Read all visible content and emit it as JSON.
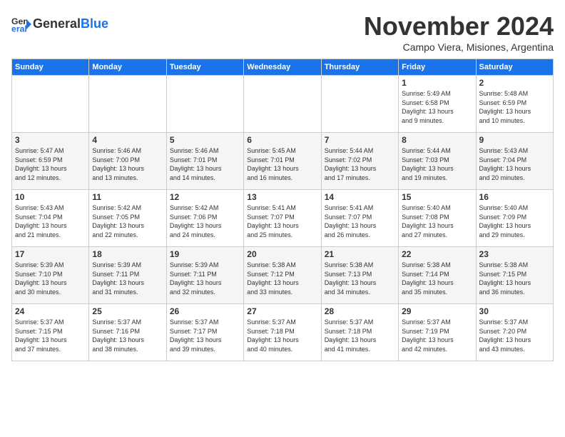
{
  "header": {
    "logo_general": "General",
    "logo_blue": "Blue",
    "month": "November 2024",
    "location": "Campo Viera, Misiones, Argentina"
  },
  "days_of_week": [
    "Sunday",
    "Monday",
    "Tuesday",
    "Wednesday",
    "Thursday",
    "Friday",
    "Saturday"
  ],
  "weeks": [
    [
      {
        "day": "",
        "info": ""
      },
      {
        "day": "",
        "info": ""
      },
      {
        "day": "",
        "info": ""
      },
      {
        "day": "",
        "info": ""
      },
      {
        "day": "",
        "info": ""
      },
      {
        "day": "1",
        "info": "Sunrise: 5:49 AM\nSunset: 6:58 PM\nDaylight: 13 hours\nand 9 minutes."
      },
      {
        "day": "2",
        "info": "Sunrise: 5:48 AM\nSunset: 6:59 PM\nDaylight: 13 hours\nand 10 minutes."
      }
    ],
    [
      {
        "day": "3",
        "info": "Sunrise: 5:47 AM\nSunset: 6:59 PM\nDaylight: 13 hours\nand 12 minutes."
      },
      {
        "day": "4",
        "info": "Sunrise: 5:46 AM\nSunset: 7:00 PM\nDaylight: 13 hours\nand 13 minutes."
      },
      {
        "day": "5",
        "info": "Sunrise: 5:46 AM\nSunset: 7:01 PM\nDaylight: 13 hours\nand 14 minutes."
      },
      {
        "day": "6",
        "info": "Sunrise: 5:45 AM\nSunset: 7:01 PM\nDaylight: 13 hours\nand 16 minutes."
      },
      {
        "day": "7",
        "info": "Sunrise: 5:44 AM\nSunset: 7:02 PM\nDaylight: 13 hours\nand 17 minutes."
      },
      {
        "day": "8",
        "info": "Sunrise: 5:44 AM\nSunset: 7:03 PM\nDaylight: 13 hours\nand 19 minutes."
      },
      {
        "day": "9",
        "info": "Sunrise: 5:43 AM\nSunset: 7:04 PM\nDaylight: 13 hours\nand 20 minutes."
      }
    ],
    [
      {
        "day": "10",
        "info": "Sunrise: 5:43 AM\nSunset: 7:04 PM\nDaylight: 13 hours\nand 21 minutes."
      },
      {
        "day": "11",
        "info": "Sunrise: 5:42 AM\nSunset: 7:05 PM\nDaylight: 13 hours\nand 22 minutes."
      },
      {
        "day": "12",
        "info": "Sunrise: 5:42 AM\nSunset: 7:06 PM\nDaylight: 13 hours\nand 24 minutes."
      },
      {
        "day": "13",
        "info": "Sunrise: 5:41 AM\nSunset: 7:07 PM\nDaylight: 13 hours\nand 25 minutes."
      },
      {
        "day": "14",
        "info": "Sunrise: 5:41 AM\nSunset: 7:07 PM\nDaylight: 13 hours\nand 26 minutes."
      },
      {
        "day": "15",
        "info": "Sunrise: 5:40 AM\nSunset: 7:08 PM\nDaylight: 13 hours\nand 27 minutes."
      },
      {
        "day": "16",
        "info": "Sunrise: 5:40 AM\nSunset: 7:09 PM\nDaylight: 13 hours\nand 29 minutes."
      }
    ],
    [
      {
        "day": "17",
        "info": "Sunrise: 5:39 AM\nSunset: 7:10 PM\nDaylight: 13 hours\nand 30 minutes."
      },
      {
        "day": "18",
        "info": "Sunrise: 5:39 AM\nSunset: 7:11 PM\nDaylight: 13 hours\nand 31 minutes."
      },
      {
        "day": "19",
        "info": "Sunrise: 5:39 AM\nSunset: 7:11 PM\nDaylight: 13 hours\nand 32 minutes."
      },
      {
        "day": "20",
        "info": "Sunrise: 5:38 AM\nSunset: 7:12 PM\nDaylight: 13 hours\nand 33 minutes."
      },
      {
        "day": "21",
        "info": "Sunrise: 5:38 AM\nSunset: 7:13 PM\nDaylight: 13 hours\nand 34 minutes."
      },
      {
        "day": "22",
        "info": "Sunrise: 5:38 AM\nSunset: 7:14 PM\nDaylight: 13 hours\nand 35 minutes."
      },
      {
        "day": "23",
        "info": "Sunrise: 5:38 AM\nSunset: 7:15 PM\nDaylight: 13 hours\nand 36 minutes."
      }
    ],
    [
      {
        "day": "24",
        "info": "Sunrise: 5:37 AM\nSunset: 7:15 PM\nDaylight: 13 hours\nand 37 minutes."
      },
      {
        "day": "25",
        "info": "Sunrise: 5:37 AM\nSunset: 7:16 PM\nDaylight: 13 hours\nand 38 minutes."
      },
      {
        "day": "26",
        "info": "Sunrise: 5:37 AM\nSunset: 7:17 PM\nDaylight: 13 hours\nand 39 minutes."
      },
      {
        "day": "27",
        "info": "Sunrise: 5:37 AM\nSunset: 7:18 PM\nDaylight: 13 hours\nand 40 minutes."
      },
      {
        "day": "28",
        "info": "Sunrise: 5:37 AM\nSunset: 7:18 PM\nDaylight: 13 hours\nand 41 minutes."
      },
      {
        "day": "29",
        "info": "Sunrise: 5:37 AM\nSunset: 7:19 PM\nDaylight: 13 hours\nand 42 minutes."
      },
      {
        "day": "30",
        "info": "Sunrise: 5:37 AM\nSunset: 7:20 PM\nDaylight: 13 hours\nand 43 minutes."
      }
    ]
  ]
}
